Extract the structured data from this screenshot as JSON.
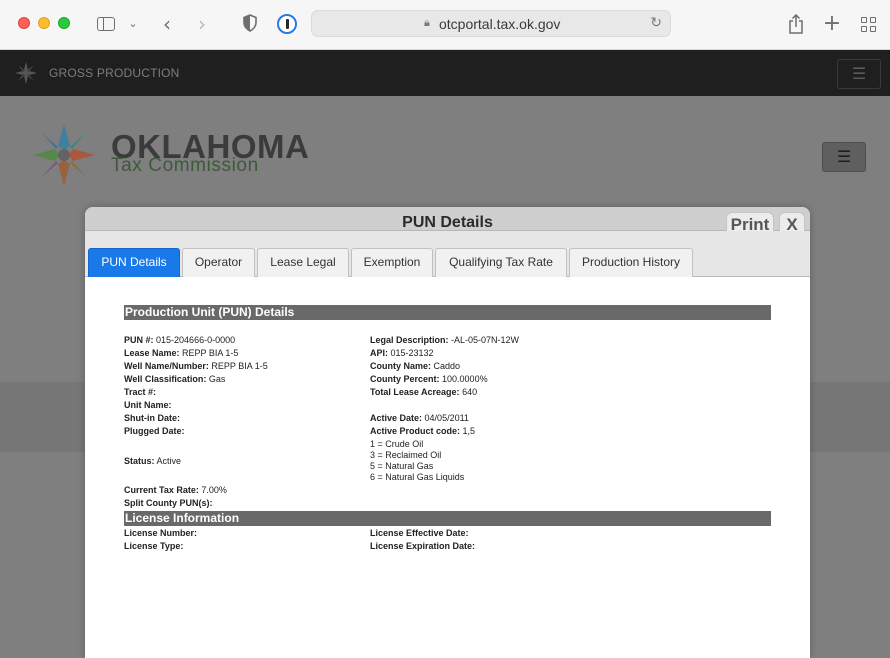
{
  "browser": {
    "url": "otcportal.tax.ok.gov"
  },
  "site": {
    "nav_title": "GROSS PRODUCTION",
    "brand_line1": "OKLAHOMA",
    "brand_line2": "Tax Commission"
  },
  "modal": {
    "title": "PUN Details",
    "print_label": "Print",
    "close_label": "X",
    "tabs": [
      {
        "label": "PUN Details",
        "active": true
      },
      {
        "label": "Operator"
      },
      {
        "label": "Lease Legal"
      },
      {
        "label": "Exemption"
      },
      {
        "label": "Qualifying Tax Rate"
      },
      {
        "label": "Production History"
      }
    ],
    "section1_title": "Production Unit (PUN) Details",
    "left": {
      "pun_label": "PUN #:",
      "pun_value": "015-204666-0-0000",
      "lease_name_label": "Lease Name:",
      "lease_name_value": "REPP BIA 1-5",
      "well_label": "Well Name/Number:",
      "well_value": "REPP BIA 1-5",
      "class_label": "Well Classification:",
      "class_value": "Gas",
      "tract_label": "Tract #:",
      "tract_value": "",
      "unit_label": "Unit Name:",
      "unit_value": "",
      "shutin_label": "Shut-in Date:",
      "shutin_value": "",
      "plugged_label": "Plugged Date:",
      "plugged_value": "",
      "status_label": "Status:",
      "status_value": "Active",
      "tax_label": "Current Tax Rate:",
      "tax_value": "7.00%",
      "split_label": "Split County PUN(s):",
      "split_value": ""
    },
    "right": {
      "legal_label": "Legal Description:",
      "legal_value": "-AL-05-07N-12W",
      "api_label": "API:",
      "api_value": "015-23132",
      "county_label": "County Name:",
      "county_value": "Caddo",
      "percent_label": "County Percent:",
      "percent_value": "100.0000%",
      "acreage_label": "Total Lease Acreage:",
      "acreage_value": "640",
      "active_date_label": "Active Date:",
      "active_date_value": "04/05/2011",
      "product_code_label": "Active Product code:",
      "product_code_value": "1,5",
      "products": [
        "1 = Crude Oil",
        "3 = Reclaimed Oil",
        "5 = Natural Gas",
        "6 = Natural Gas Liquids"
      ]
    },
    "section2_title": "License Information",
    "license": {
      "number_label": "License Number:",
      "number_value": "",
      "type_label": "License Type:",
      "type_value": "",
      "effective_label": "License Effective Date:",
      "effective_value": "",
      "expiration_label": "License Expiration Date:",
      "expiration_value": ""
    }
  }
}
